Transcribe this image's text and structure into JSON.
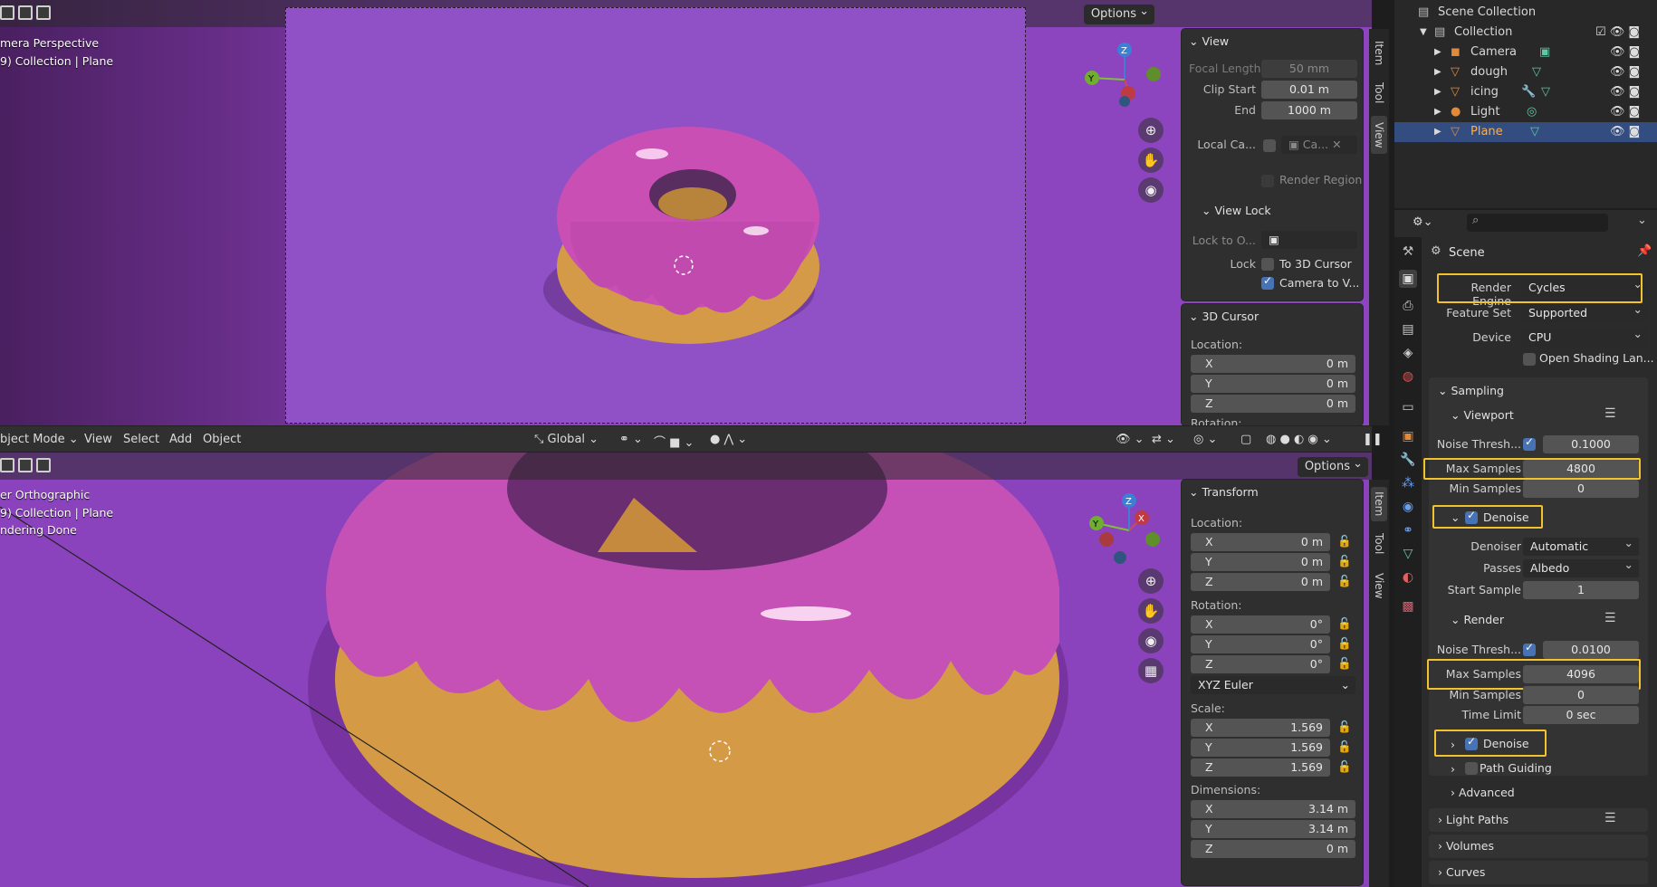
{
  "top_viewport": {
    "options": "Options",
    "overlay_line1": "mera Perspective",
    "overlay_line2": "9) Collection | Plane"
  },
  "bottom_viewport": {
    "options": "Options",
    "overlay_line1": "er Orthographic",
    "overlay_line2": "9) Collection | Plane",
    "overlay_line3": "ndering Done"
  },
  "header": {
    "mode": "bject Mode",
    "menus": [
      "View",
      "Select",
      "Add",
      "Object"
    ],
    "orientation": "Global"
  },
  "sidebar_tabs": [
    "Item",
    "Tool",
    "View"
  ],
  "view_panel": {
    "title": "View",
    "focal_length_label": "Focal Length",
    "focal_length": "50 mm",
    "clip_start_label": "Clip Start",
    "clip_start": "0.01 m",
    "end_label": "End",
    "end": "1000 m",
    "local_camera_label": "Local Ca...",
    "local_camera_value": "Ca...",
    "render_region": "Render Region",
    "view_lock": "View Lock",
    "lock_to_object": "Lock to O...",
    "lock_label": "Lock",
    "to_3d_cursor": "To 3D Cursor",
    "camera_to_view": "Camera to V..."
  },
  "cursor_panel": {
    "title": "3D Cursor",
    "location_label": "Location:",
    "x": "0 m",
    "y": "0 m",
    "z": "0 m",
    "rotation_label": "Rotation:"
  },
  "transform_panel": {
    "title": "Transform",
    "location_label": "Location:",
    "loc": [
      "0 m",
      "0 m",
      "0 m"
    ],
    "rotation_label": "Rotation:",
    "rot": [
      "0°",
      "0°",
      "0°"
    ],
    "rotation_mode": "XYZ Euler",
    "scale_label": "Scale:",
    "scale": [
      "1.569",
      "1.569",
      "1.569"
    ],
    "dimensions_label": "Dimensions:",
    "dim": [
      "3.14 m",
      "3.14 m",
      "0 m"
    ],
    "axes": [
      "X",
      "Y",
      "Z"
    ]
  },
  "outliner": {
    "scene_collection": "Scene Collection",
    "collection": "Collection",
    "items": [
      {
        "name": "Camera"
      },
      {
        "name": "dough"
      },
      {
        "name": "icing"
      },
      {
        "name": "Light"
      },
      {
        "name": "Plane"
      }
    ]
  },
  "properties": {
    "scene": "Scene",
    "render_engine_label": "Render Engine",
    "render_engine": "Cycles",
    "feature_set_label": "Feature Set",
    "feature_set": "Supported",
    "device_label": "Device",
    "device": "CPU",
    "osl": "Open Shading Lan...",
    "sampling": "Sampling",
    "viewport": "Viewport",
    "noise_thresh_label": "Noise Thresh...",
    "vp_noise": "0.1000",
    "max_samples_label": "Max Samples",
    "vp_max": "4800",
    "min_samples_label": "Min Samples",
    "vp_min": "0",
    "denoise": "Denoise",
    "denoiser_label": "Denoiser",
    "denoiser": "Automatic",
    "passes_label": "Passes",
    "passes": "Albedo",
    "start_sample_label": "Start Sample",
    "start_sample": "1",
    "render": "Render",
    "r_noise": "0.0100",
    "r_max": "4096",
    "r_min": "0",
    "time_limit_label": "Time Limit",
    "time_limit": "0 sec",
    "path_guiding": "Path Guiding",
    "advanced": "Advanced",
    "light_paths": "Light Paths",
    "volumes": "Volumes",
    "curves": "Curves"
  },
  "accent_colors": {
    "highlight": "#f2c230",
    "selection": "#334d80",
    "checkbox": "#4772b3",
    "background": "#8a43bd"
  }
}
